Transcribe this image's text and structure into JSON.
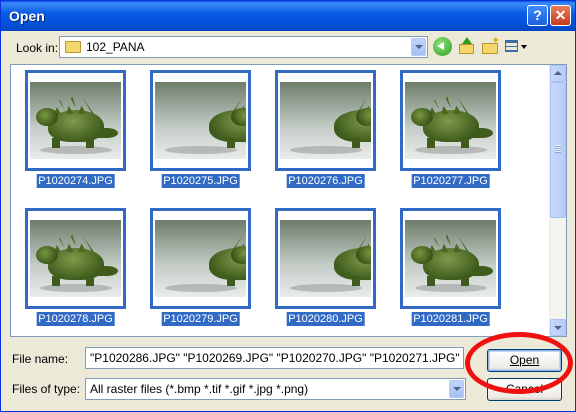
{
  "window": {
    "title": "Open"
  },
  "title_buttons": {
    "help": "?",
    "close": "✕"
  },
  "toolbar": {
    "lookin_label": "Look in:",
    "lookin_value": "102_PANA",
    "icons": [
      "back-arrow-icon",
      "up-folder-icon",
      "new-folder-icon",
      "views-menu-icon"
    ]
  },
  "files": [
    {
      "name": "P1020274.JPG"
    },
    {
      "name": "P1020275.JPG"
    },
    {
      "name": "P1020276.JPG"
    },
    {
      "name": "P1020277.JPG"
    },
    {
      "name": "P1020278.JPG"
    },
    {
      "name": "P1020279.JPG"
    },
    {
      "name": "P1020280.JPG"
    },
    {
      "name": "P1020281.JPG"
    }
  ],
  "form": {
    "filename_label": "File name:",
    "filename_value": "\"P1020286.JPG\" \"P1020269.JPG\" \"P1020270.JPG\" \"P1020271.JPG\" \"P1020",
    "filetype_label": "Files of type:",
    "filetype_value": "All raster files (*.bmp *.tif *.gif *.jpg *.png)"
  },
  "buttons": {
    "open": "Open",
    "cancel": "Cancel"
  },
  "colors": {
    "selection": "#316ac5",
    "highlight_circle": "#f01010",
    "titlebar": "#0a5ce6"
  }
}
